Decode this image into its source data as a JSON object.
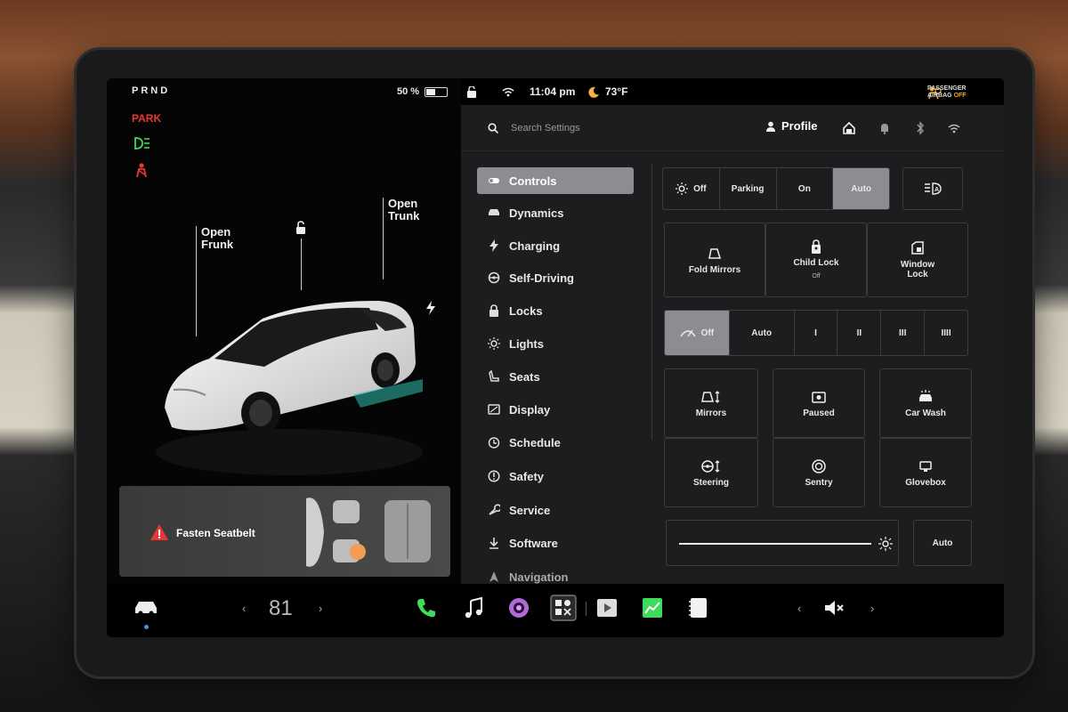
{
  "status": {
    "gear": "PRND",
    "park_label": "PARK",
    "battery_percent": "50 %",
    "battery_level": 0.5,
    "time": "11:04 pm",
    "temperature": "73°F",
    "airbag_line1": "PASSENGER",
    "airbag_line2": "AIRBAG",
    "airbag_state": "OFF"
  },
  "car_view": {
    "frunk_label_1": "Open",
    "frunk_label_2": "Frunk",
    "trunk_label_1": "Open",
    "trunk_label_2": "Trunk",
    "alert": "Fasten Seatbelt"
  },
  "settings": {
    "search_placeholder": "Search Settings",
    "profile_label": "Profile",
    "menu": [
      {
        "label": "Controls",
        "icon": "toggle-icon"
      },
      {
        "label": "Dynamics",
        "icon": "car-icon"
      },
      {
        "label": "Charging",
        "icon": "bolt-icon"
      },
      {
        "label": "Self-Driving",
        "icon": "steering-wheel-icon"
      },
      {
        "label": "Locks",
        "icon": "lock-icon"
      },
      {
        "label": "Lights",
        "icon": "sun-icon"
      },
      {
        "label": "Seats",
        "icon": "seat-icon"
      },
      {
        "label": "Display",
        "icon": "display-icon"
      },
      {
        "label": "Schedule",
        "icon": "clock-icon"
      },
      {
        "label": "Safety",
        "icon": "info-icon"
      },
      {
        "label": "Service",
        "icon": "wrench-icon"
      },
      {
        "label": "Software",
        "icon": "download-icon"
      },
      {
        "label": "Navigation",
        "icon": "navigation-icon"
      }
    ],
    "headlights": [
      "Off",
      "Parking",
      "On",
      "Auto"
    ],
    "headlights_selected": "Auto",
    "tiles_row1": [
      {
        "label": "Fold Mirrors",
        "sub": ""
      },
      {
        "label": "Child Lock",
        "sub": "Off"
      },
      {
        "label": "Window Lock",
        "sub": ""
      }
    ],
    "wipers": [
      "Off",
      "Auto",
      "I",
      "II",
      "III",
      "IIII"
    ],
    "wipers_selected": "Off",
    "tiles_grid": [
      "Mirrors",
      "Paused",
      "Car Wash",
      "Steering",
      "Sentry",
      "Glovebox"
    ],
    "brightness_mode": "Auto"
  },
  "dock": {
    "cabin_temp": "81",
    "apps": [
      "phone-icon",
      "music-icon",
      "camera-icon",
      "toybox-icon",
      "theater-icon",
      "chart-icon",
      "notes-icon"
    ]
  },
  "colors": {
    "accent_red": "#e53935",
    "selected_bg": "#8d8d91",
    "panel_bg": "#1d1d1f"
  }
}
